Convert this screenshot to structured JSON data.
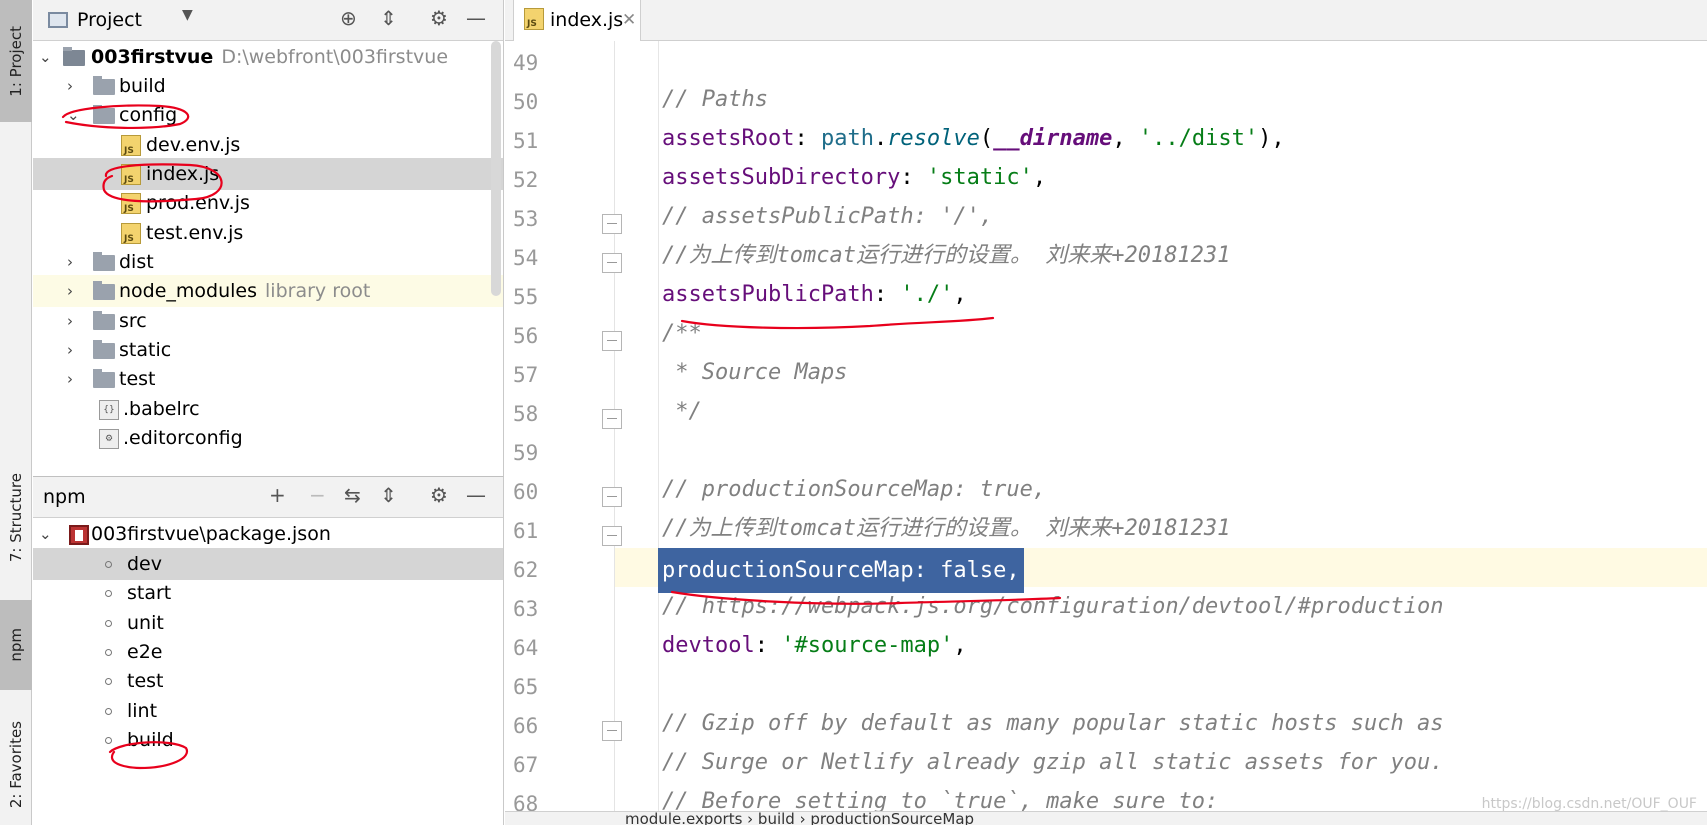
{
  "side_strip": {
    "project_tab": "1: Project",
    "structure_tab": "7: Structure",
    "npm_tab": "npm",
    "favorites_tab": "2: Favorites"
  },
  "project_panel": {
    "title": "Project",
    "tree": [
      {
        "label": "003firstvue",
        "hint": "D:\\webfront\\003firstvue",
        "kind": "root"
      },
      {
        "label": "build",
        "kind": "folder"
      },
      {
        "label": "config",
        "kind": "folder-open"
      },
      {
        "label": "dev.env.js",
        "kind": "js"
      },
      {
        "label": "index.js",
        "kind": "js",
        "selected": true
      },
      {
        "label": "prod.env.js",
        "kind": "js"
      },
      {
        "label": "test.env.js",
        "kind": "js"
      },
      {
        "label": "dist",
        "kind": "folder"
      },
      {
        "label": "node_modules",
        "hint": "library root",
        "kind": "folder"
      },
      {
        "label": "src",
        "kind": "folder"
      },
      {
        "label": "static",
        "kind": "folder"
      },
      {
        "label": "test",
        "kind": "folder"
      },
      {
        "label": ".babelrc",
        "kind": "config"
      },
      {
        "label": ".editorconfig",
        "kind": "config"
      }
    ]
  },
  "npm_panel": {
    "title": "npm",
    "package": "003firstvue\\package.json",
    "scripts": [
      "dev",
      "start",
      "unit",
      "e2e",
      "test",
      "lint",
      "build"
    ]
  },
  "editor": {
    "tab_label": "index.js",
    "tab_icon_text": "JS",
    "lines": [
      {
        "n": "49",
        "text": ""
      },
      {
        "n": "50",
        "text": "// Paths"
      },
      {
        "n": "51",
        "text": "assetsRoot: path.resolve(__dirname, '../dist'),"
      },
      {
        "n": "52",
        "text": "assetsSubDirectory: 'static',"
      },
      {
        "n": "53",
        "text": "// assetsPublicPath: '/',"
      },
      {
        "n": "54",
        "text": "//为上传到tomcat运行进行的设置。 刘来来+20181231"
      },
      {
        "n": "55",
        "text": "assetsPublicPath: './',"
      },
      {
        "n": "56",
        "text": "/**"
      },
      {
        "n": "57",
        "text": " * Source Maps"
      },
      {
        "n": "58",
        "text": " */"
      },
      {
        "n": "59",
        "text": ""
      },
      {
        "n": "60",
        "text": "// productionSourceMap: true,"
      },
      {
        "n": "61",
        "text": "//为上传到tomcat运行进行的设置。 刘来来+20181231"
      },
      {
        "n": "62",
        "text": "productionSourceMap: false,"
      },
      {
        "n": "63",
        "text": "// https://webpack.js.org/configuration/devtool/#production"
      },
      {
        "n": "64",
        "text": "devtool: '#source-map',"
      },
      {
        "n": "65",
        "text": ""
      },
      {
        "n": "66",
        "text": "// Gzip off by default as many popular static hosts such as"
      },
      {
        "n": "67",
        "text": "// Surge or Netlify already gzip all static assets for you."
      },
      {
        "n": "68",
        "text": "// Before setting to `true`, make sure to:"
      }
    ],
    "breadcrumb": "module.exports › build › productionSourceMap",
    "watermark": "https://blog.csdn.net/OUF_OUF"
  },
  "colors": {
    "comment": "#808080",
    "property": "#660e7a",
    "string": "#067d17",
    "selection": "#3e64a0",
    "annotation_red": "#e8001c"
  }
}
